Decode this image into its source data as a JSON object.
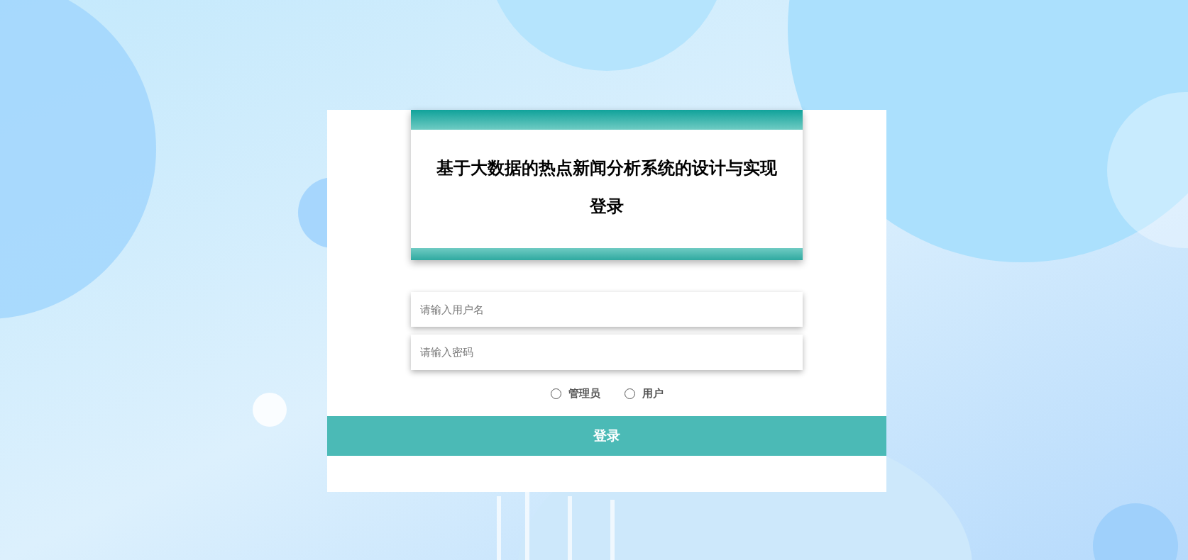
{
  "header": {
    "title": "基于大数据的热点新闻分析系统的设计与实现",
    "subtitle": "登录"
  },
  "fields": [
    {
      "placeholder": "请输入用户名"
    },
    {
      "placeholder": "请输入密码"
    }
  ],
  "roles": [
    {
      "label": "管理员",
      "selected": false
    },
    {
      "label": "用户",
      "selected": false
    }
  ],
  "login_button": "登录"
}
